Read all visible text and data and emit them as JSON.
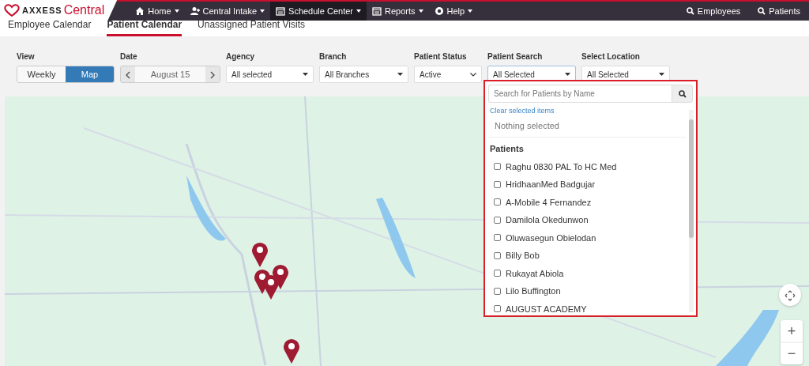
{
  "header": {
    "logo_brand": "AXXESS",
    "logo_product": "Central",
    "nav": [
      {
        "label": "Home",
        "selected": false
      },
      {
        "label": "Central Intake",
        "selected": false
      },
      {
        "label": "Schedule Center",
        "selected": true
      },
      {
        "label": "Reports",
        "selected": false
      },
      {
        "label": "Help",
        "selected": false
      }
    ],
    "search_links": [
      "Employees",
      "Patients"
    ]
  },
  "tabs": [
    {
      "label": "Employee Calendar",
      "selected": false
    },
    {
      "label": "Patient Calendar",
      "selected": true
    },
    {
      "label": "Unassigned Patient Visits",
      "selected": false
    }
  ],
  "filters": {
    "view": {
      "label": "View",
      "options": [
        {
          "label": "Weekly",
          "selected": false
        },
        {
          "label": "Map",
          "selected": true
        }
      ]
    },
    "date": {
      "label": "Date",
      "value": "August 15"
    },
    "selects": [
      {
        "label": "Agency",
        "value": "All selected",
        "kind": "caret"
      },
      {
        "label": "Branch",
        "value": "All Branches",
        "kind": "caret"
      },
      {
        "label": "Patient Status",
        "value": "Active",
        "kind": "chevron"
      },
      {
        "label": "Patient Search",
        "value": "All Selected",
        "kind": "caret",
        "expanded": true
      },
      {
        "label": "Select Location",
        "value": "All Selected",
        "kind": "caret",
        "expanded": false
      }
    ]
  },
  "patient_dropdown": {
    "placeholder": "Search for Patients by Name",
    "clear_link": "Clear selected items",
    "summary": "Nothing selected",
    "group": "Patients",
    "items": [
      {
        "label": "Raghu 0830 PAL To HC Med",
        "checked": false
      },
      {
        "label": "HridhaanMed Badgujar",
        "checked": false
      },
      {
        "label": "A-Mobile 4 Fernandez",
        "checked": false
      },
      {
        "label": "Damilola Okedunwon",
        "checked": false
      },
      {
        "label": "Oluwasegun Obielodan",
        "checked": false
      },
      {
        "label": "Billy Bob",
        "checked": false
      },
      {
        "label": "Rukayat Abiola",
        "checked": false
      },
      {
        "label": "Lilo Buffington",
        "checked": false
      },
      {
        "label": "AUGUST ACADEMY",
        "checked": false
      }
    ]
  },
  "map": {
    "zoom_in": "+",
    "zoom_out": "−"
  }
}
